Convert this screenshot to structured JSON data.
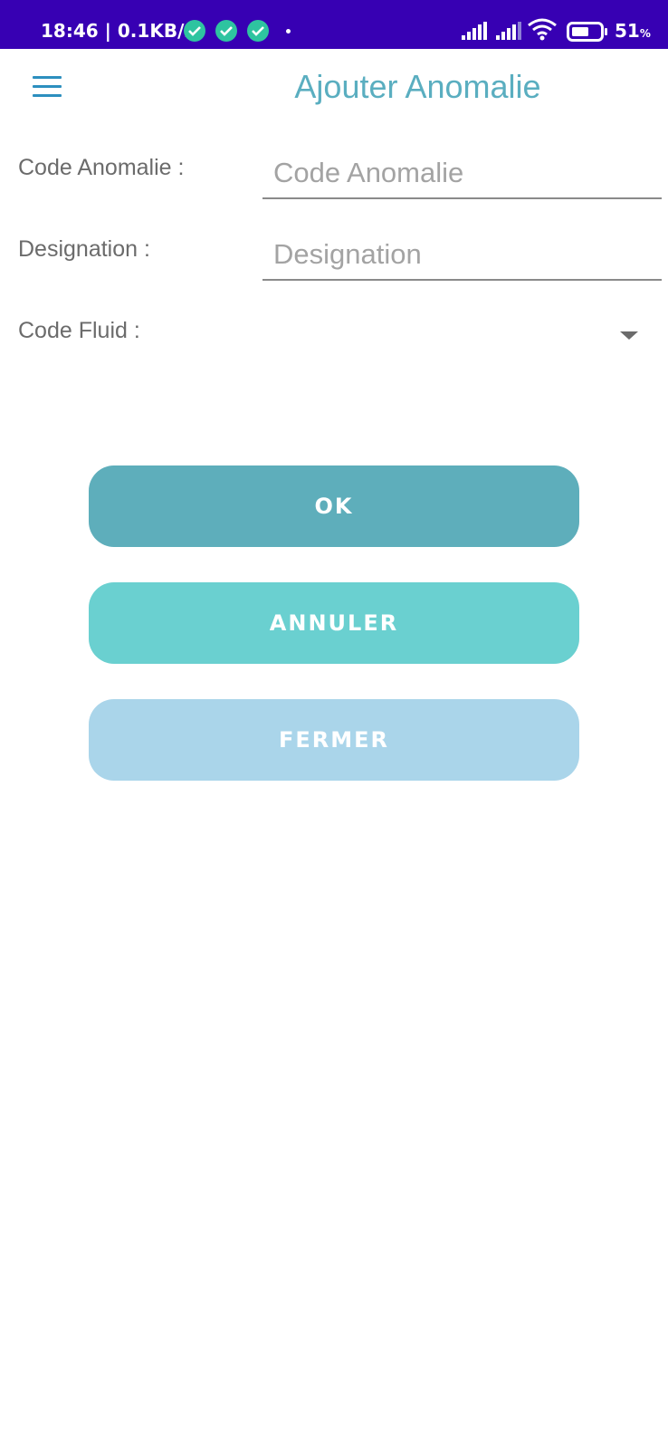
{
  "status_bar": {
    "time_speed": "18:46 | 0.1KB/s",
    "battery_percent": "51",
    "battery_unit": "%",
    "icons": [
      "check-circle-icon",
      "check-circle-icon",
      "check-circle-icon",
      "dot-icon",
      "signal-icon",
      "signal-icon",
      "wifi-icon",
      "battery-icon"
    ],
    "bar_color": "#3700b3"
  },
  "app_bar": {
    "title": "Ajouter Anomalie",
    "menu_icon": "hamburger-menu-icon",
    "title_color": "#5aaec0"
  },
  "form": {
    "code_anomalie_label": "Code Anomalie :",
    "code_anomalie_placeholder": "Code Anomalie",
    "code_anomalie_value": "",
    "designation_label": "Designation :",
    "designation_placeholder": "Designation",
    "designation_value": "",
    "code_fluid_label": "Code Fluid :",
    "code_fluid_value": ""
  },
  "buttons": {
    "ok_label": "OK",
    "annuler_label": "ANNULER",
    "fermer_label": "FERMER",
    "ok_color": "#5eaebb",
    "annuler_color": "#6ad0d0",
    "fermer_color": "#aad5ea"
  }
}
